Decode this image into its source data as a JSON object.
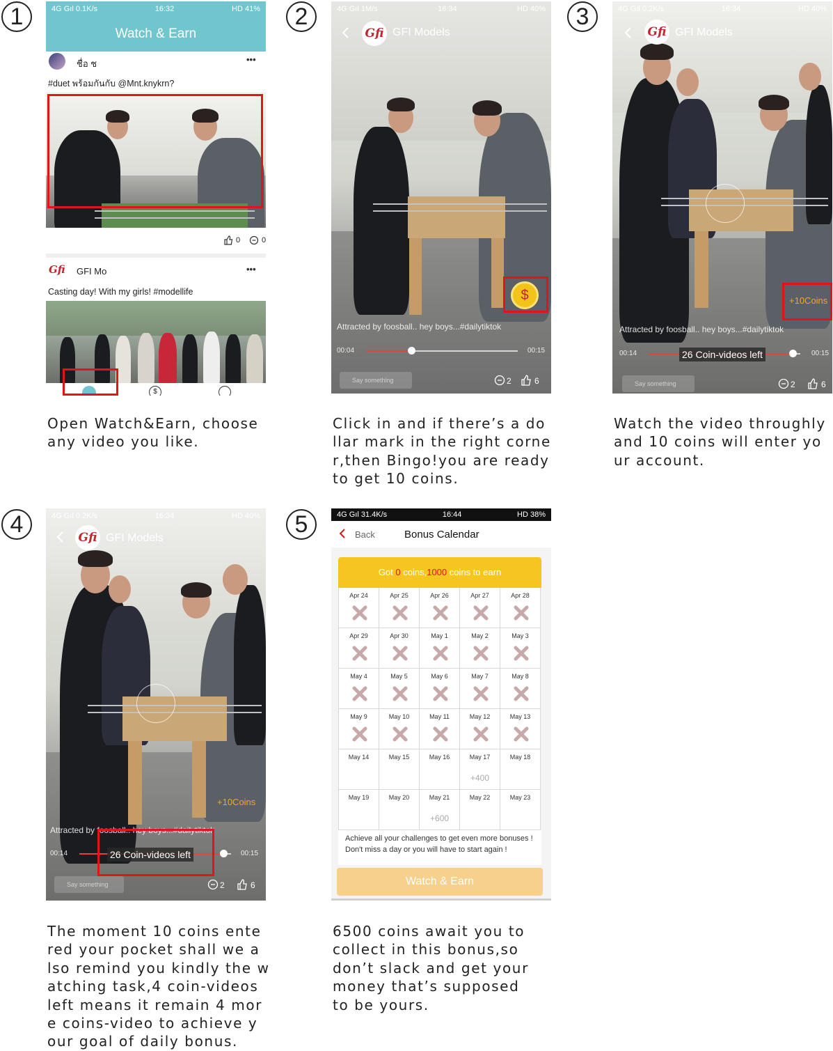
{
  "steps": [
    {
      "number": "1",
      "caption": "Open Watch&Earn, choose\nany video you like.",
      "screen": {
        "status_left": "4G Gıl 0.1K/s",
        "status_time": "16:32",
        "status_right": "HD 41%",
        "header_title": "Watch & Earn",
        "post1_user": "ชื่อ ช",
        "post1_text": "#duet พร้อมกันกับ @Mnt.knykrn?",
        "post1_likes": "0",
        "post1_comments": "0",
        "post2_user": "GFI Mo",
        "post2_logo": "Gfi",
        "post2_text": "Casting day! With my girls! #modellife",
        "more_label": "•••"
      }
    },
    {
      "number": "2",
      "caption": "Click in and if there’s a do\nllar mark in the right corne\nr,then Bingo!you are ready\nto get 10 coins.",
      "screen": {
        "status_left": "4G Gıl 1M/s",
        "status_time": "16:34",
        "status_right": "HD 40%",
        "channel": "GFI Models",
        "logo": "Gfi",
        "video_caption": "Attracted by foosball.. hey boys...#dailytiktok",
        "time_current": "00:04",
        "time_total": "00:15",
        "progress": 0.3,
        "say_placeholder": "Say something",
        "comments": "2",
        "likes": "6",
        "coin_symbol": "$"
      }
    },
    {
      "number": "3",
      "caption": "Watch the video throughly\nand 10 coins will enter yo\nur account.",
      "screen": {
        "status_left": "4G Gıl 0.2K/s",
        "status_time": "16:34",
        "status_right": "HD 40%",
        "channel": "GFI Models",
        "logo": "Gfi",
        "coins_popup": "+10Coins",
        "video_caption": "Attracted by foosball.. hey boys...#dailytiktok",
        "time_current": "00:14",
        "time_total": "00:15",
        "progress": 0.95,
        "coin_videos_left": "26 Coin-videos left",
        "say_placeholder": "Say something",
        "comments": "2",
        "likes": "6"
      }
    },
    {
      "number": "4",
      "caption": "The moment 10 coins ente\nred your pocket shall we a\nlso remind you kindly the w\natching task,4 coin-videos\nleft means it remain 4 mor\ne coins-video to achieve y\nour goal of daily bonus.",
      "screen": {
        "status_left": "4G Gıl 0.2K/s",
        "status_time": "16:34",
        "status_right": "HD 40%",
        "channel": "GFI Models",
        "logo": "Gfi",
        "coins_popup": "+10Coins",
        "video_caption": "Attracted by foosball.. hey boys...#dailytiktok",
        "time_current": "00:14",
        "time_total": "00:15",
        "progress": 0.95,
        "coin_videos_left": "26 Coin-videos left",
        "say_placeholder": "Say something",
        "comments": "2",
        "likes": "6"
      }
    },
    {
      "number": "5",
      "caption": "6500 coins await you to\ncollect in this bonus,so\ndon’t slack and get your\nmoney that’s supposed\nto be yours.",
      "screen": {
        "status_left": "4G Gıl 31.4K/s",
        "status_time": "16:44",
        "status_right": "HD 38%",
        "back_label": "Back",
        "title": "Bonus Calendar",
        "banner_prefix": "Got ",
        "banner_coins": "0",
        "banner_mid": " coins,",
        "banner_target": "1000",
        "banner_suffix": " coins to earn",
        "footer_text": "Achieve all your challenges to get even more bonuses ! Don't miss a day or you will have to start again !",
        "button_label": "Watch & Earn",
        "days": [
          {
            "date": "Apr 24",
            "missed": true
          },
          {
            "date": "Apr 25",
            "missed": true
          },
          {
            "date": "Apr 26",
            "missed": true
          },
          {
            "date": "Apr 27",
            "missed": true
          },
          {
            "date": "Apr 28",
            "missed": true
          },
          {
            "date": "Apr 29",
            "missed": true
          },
          {
            "date": "Apr 30",
            "missed": true
          },
          {
            "date": "May 1",
            "missed": true
          },
          {
            "date": "May 2",
            "missed": true
          },
          {
            "date": "May 3",
            "missed": true
          },
          {
            "date": "May 4",
            "missed": true
          },
          {
            "date": "May 5",
            "missed": true
          },
          {
            "date": "May 6",
            "missed": true
          },
          {
            "date": "May 7",
            "missed": true
          },
          {
            "date": "May 8",
            "missed": true
          },
          {
            "date": "May 9",
            "missed": true
          },
          {
            "date": "May 10",
            "missed": true
          },
          {
            "date": "May 11",
            "missed": true
          },
          {
            "date": "May 12",
            "missed": true
          },
          {
            "date": "May 13",
            "missed": true
          },
          {
            "date": "May 14",
            "missed": false,
            "bonus": ""
          },
          {
            "date": "May 15",
            "missed": false,
            "bonus": ""
          },
          {
            "date": "May 16",
            "missed": false,
            "bonus": ""
          },
          {
            "date": "May 17",
            "missed": false,
            "bonus": "+400"
          },
          {
            "date": "May 18",
            "missed": false,
            "bonus": ""
          },
          {
            "date": "May 19",
            "missed": false,
            "bonus": ""
          },
          {
            "date": "May 20",
            "missed": false,
            "bonus": ""
          },
          {
            "date": "May 21",
            "missed": false,
            "bonus": "+600"
          },
          {
            "date": "May 22",
            "missed": false,
            "bonus": ""
          },
          {
            "date": "May 23",
            "missed": false,
            "bonus": ""
          }
        ]
      }
    }
  ],
  "colors": {
    "teal_header": "#71c5cf",
    "highlight_red": "#e2141b",
    "banner_yellow": "#f7c521",
    "button_orange": "#f6d08c",
    "coin_gold": "#f2c318"
  }
}
